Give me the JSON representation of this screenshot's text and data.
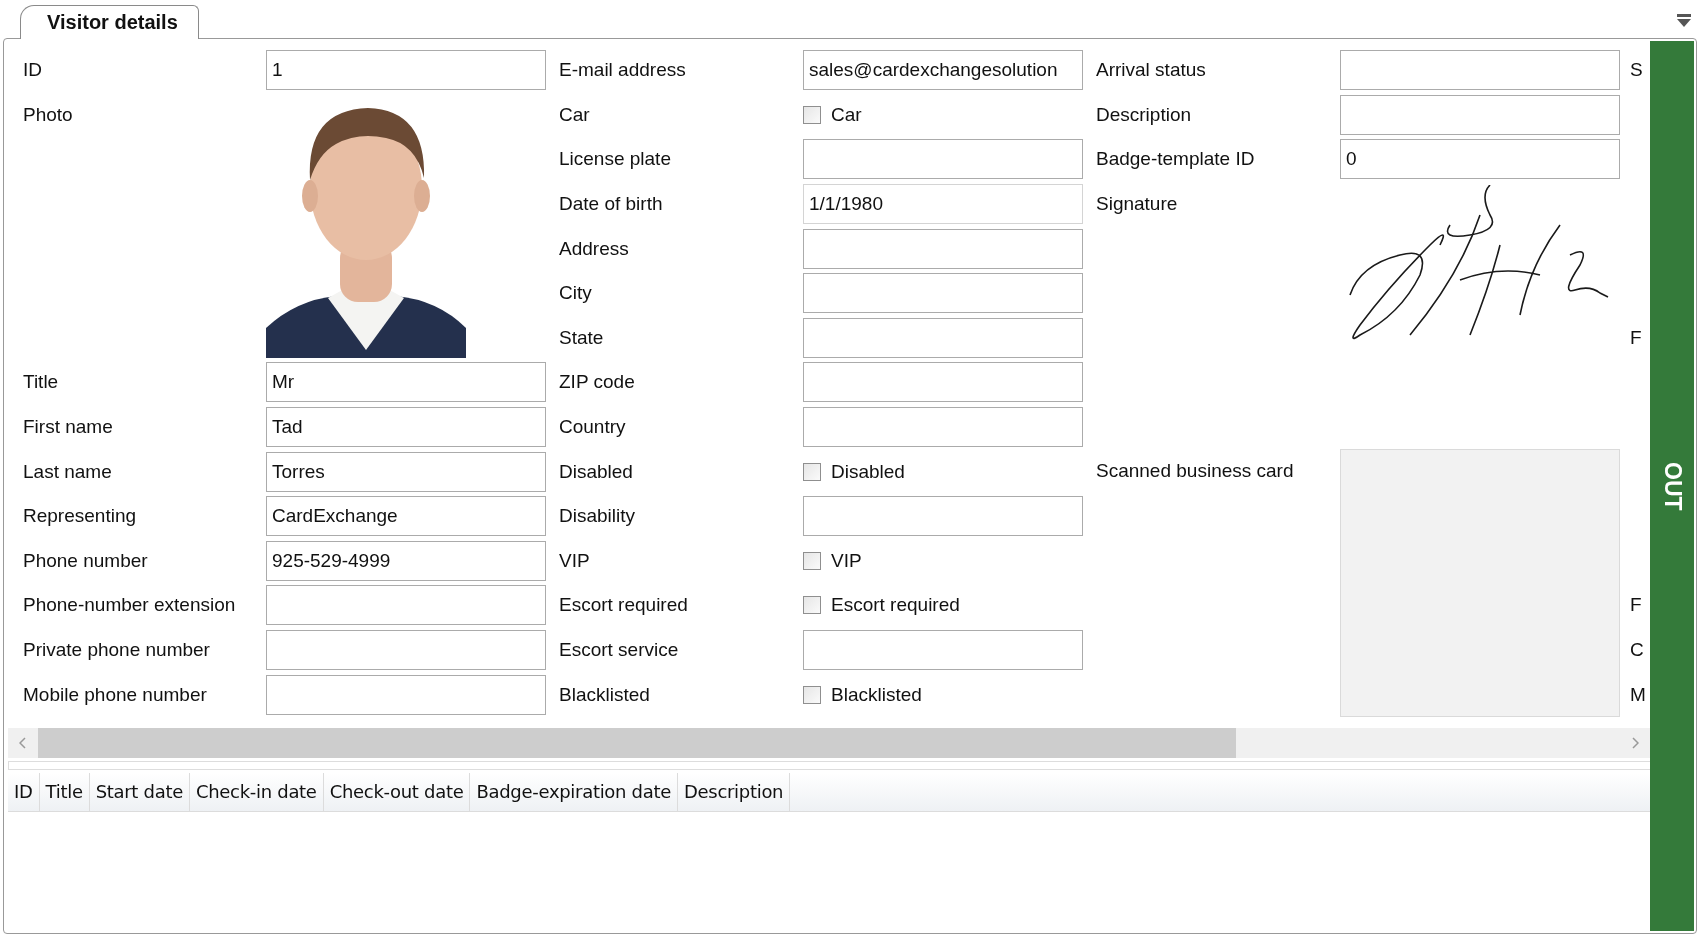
{
  "tab": {
    "label": "Visitor details",
    "selected": true
  },
  "form": {
    "column_1": [
      {
        "label": "ID",
        "kind": "text",
        "value": "1"
      },
      {
        "label": "Photo"
      },
      {
        "label": "Title",
        "kind": "text",
        "value": "Mr"
      },
      {
        "label": "First name",
        "kind": "text",
        "value": "Tad"
      },
      {
        "label": "Last name",
        "kind": "text",
        "value": "Torres"
      },
      {
        "label": "Representing",
        "kind": "text",
        "value": "CardExchange"
      },
      {
        "label": "Phone number",
        "kind": "text",
        "value": "925-529-4999"
      },
      {
        "label": "Phone-number extension",
        "kind": "text"
      },
      {
        "label": "Private phone number",
        "kind": "text"
      },
      {
        "label": "Mobile phone number",
        "kind": "text"
      }
    ],
    "column_2": [
      {
        "label": "E-mail address",
        "kind": "text",
        "value": "sales@cardexchangesolution"
      },
      {
        "label": "Car",
        "kind": "checkbox",
        "caption": "Car",
        "checked": false
      },
      {
        "label": "License plate",
        "kind": "text"
      },
      {
        "label": "Date of birth",
        "kind": "date",
        "value": "1/1/1980"
      },
      {
        "label": "Address",
        "kind": "text"
      },
      {
        "label": "City",
        "kind": "text"
      },
      {
        "label": "State",
        "kind": "text"
      },
      {
        "label": "ZIP code",
        "kind": "text"
      },
      {
        "label": "Country",
        "kind": "text"
      },
      {
        "label": "Disabled",
        "kind": "checkbox",
        "caption": "Disabled",
        "checked": false
      },
      {
        "label": "Disability",
        "kind": "text"
      },
      {
        "label": "VIP",
        "kind": "checkbox",
        "caption": "VIP",
        "checked": false
      },
      {
        "label": "Escort required",
        "kind": "checkbox",
        "caption": "Escort required",
        "checked": false
      },
      {
        "label": "Escort service",
        "kind": "text"
      },
      {
        "label": "Blacklisted",
        "kind": "checkbox",
        "caption": "Blacklisted",
        "checked": false
      }
    ],
    "column_3": [
      {
        "label": "Arrival status",
        "kind": "text"
      },
      {
        "label": "Description",
        "kind": "text"
      },
      {
        "label": "Badge-template ID",
        "kind": "text",
        "value": "0"
      },
      {
        "label": "Signature",
        "kind": "signature"
      },
      {
        "label": "Scanned business card",
        "kind": "card"
      }
    ],
    "column_4": [
      {
        "label": "S"
      },
      {
        "label": "F"
      },
      {
        "label": "F"
      },
      {
        "label": "C"
      },
      {
        "label": "M"
      }
    ]
  },
  "status_button": {
    "label": "OUT"
  },
  "table": {
    "columns": [
      "ID",
      "Title",
      "Start date",
      "Check-in date",
      "Check-out date",
      "Badge-expiration date",
      "Description"
    ]
  }
}
